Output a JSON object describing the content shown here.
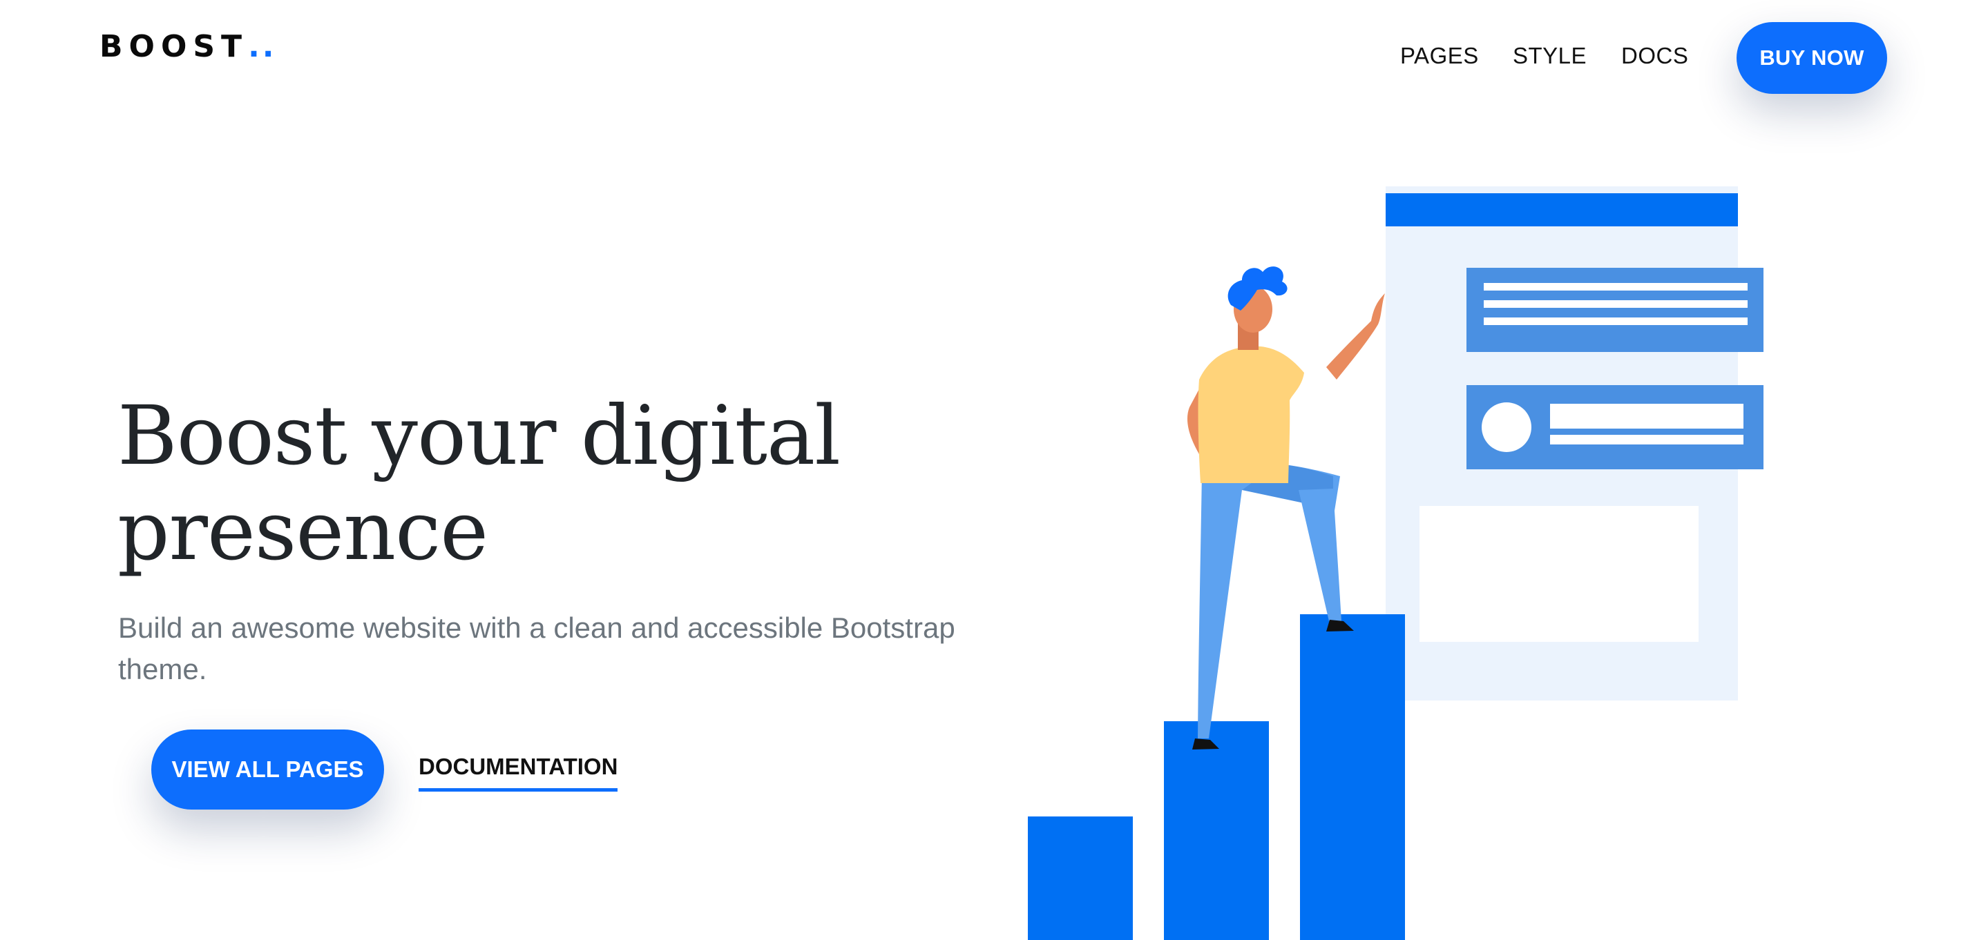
{
  "header": {
    "logo_text": "BOOST",
    "logo_dots": "..",
    "nav": [
      "PAGES",
      "STYLE",
      "DOCS"
    ],
    "buy_label": "BUY NOW"
  },
  "hero": {
    "title_line1": "Boost your digital",
    "title_line2": "presence",
    "subtitle": "Build an awesome website with a clean and accessible Bootstrap theme.",
    "primary_button": "VIEW ALL PAGES",
    "secondary_link": "DOCUMENTATION"
  },
  "colors": {
    "accent": "#0d6efd",
    "bar_blue": "#0070f3",
    "light_blue": "#4a90e2",
    "panel_bg": "#ebf3fd",
    "skin": "#e98b5e",
    "shirt": "#ffd37a",
    "pants": "#5da2f0"
  },
  "icons": [
    "person-illustration"
  ]
}
